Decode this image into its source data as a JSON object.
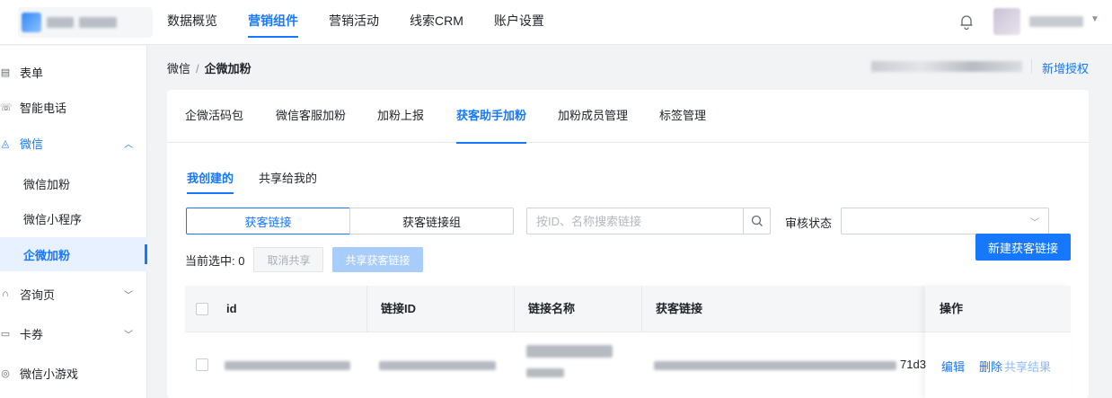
{
  "topnav": {
    "items": [
      {
        "label": "数据概览"
      },
      {
        "label": "营销组件"
      },
      {
        "label": "营销活动"
      },
      {
        "label": "线索CRM"
      },
      {
        "label": "账户设置"
      }
    ],
    "active_index": 1
  },
  "sidebar": {
    "items": [
      {
        "label": "表单",
        "icon": "form-icon"
      },
      {
        "label": "智能电话",
        "icon": "phone-icon"
      },
      {
        "label": "微信",
        "icon": "wechat-icon",
        "expanded": true
      },
      {
        "label": "微信加粉"
      },
      {
        "label": "微信小程序"
      },
      {
        "label": "企微加粉",
        "active": true
      },
      {
        "label": "咨询页",
        "icon": "headset-icon"
      },
      {
        "label": "卡券",
        "icon": "coupon-icon"
      },
      {
        "label": "微信小游戏",
        "icon": "game-icon"
      }
    ]
  },
  "breadcrumb": {
    "parent": "微信",
    "separator": "/",
    "current": "企微加粉"
  },
  "header_link": {
    "label": "新增授权"
  },
  "tabs": {
    "items": [
      {
        "label": "企微活码包"
      },
      {
        "label": "微信客服加粉"
      },
      {
        "label": "加粉上报"
      },
      {
        "label": "获客助手加粉"
      },
      {
        "label": "加粉成员管理"
      },
      {
        "label": "标签管理"
      }
    ],
    "active_index": 3
  },
  "subtabs": {
    "items": [
      {
        "label": "我创建的"
      },
      {
        "label": "共享给我的"
      }
    ],
    "active_index": 0
  },
  "segment": {
    "items": [
      {
        "label": "获客链接"
      },
      {
        "label": "获客链接组"
      }
    ],
    "active_index": 0
  },
  "search": {
    "placeholder": "按ID、名称搜索链接",
    "value": ""
  },
  "review_status": {
    "label": "审核状态",
    "value": ""
  },
  "buttons": {
    "new_link": "新建获客链接",
    "cancel_share": "取消共享",
    "share_link": "共享获客链接"
  },
  "selection": {
    "label": "当前选中: 0"
  },
  "table": {
    "columns": [
      "id",
      "链接ID",
      "链接名称",
      "获客链接",
      "操作"
    ],
    "rows": [
      {
        "link_tail": "71d3",
        "actions": [
          "编辑",
          "删除",
          "共享结果"
        ]
      }
    ]
  },
  "colors": {
    "accent": "#1677ff",
    "accent_light": "#a9cdfb"
  }
}
